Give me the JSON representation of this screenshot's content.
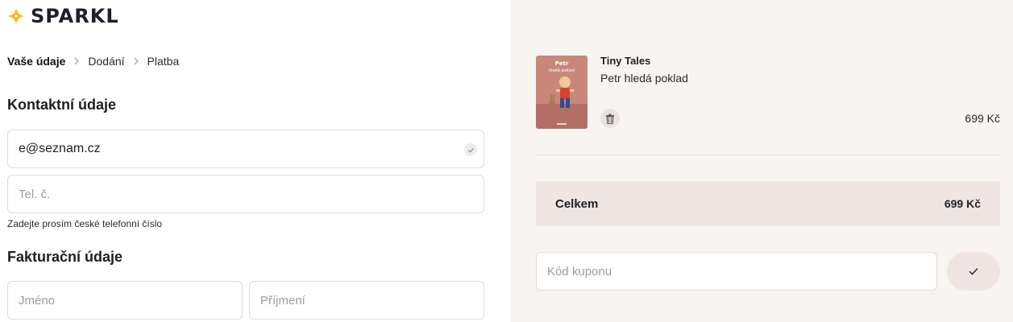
{
  "brand": {
    "name": "SPARKL",
    "logo_icon": "sparkle-icon",
    "logo_color": "#f5b718"
  },
  "breadcrumb": [
    "Vaše údaje",
    "Dodání",
    "Platba"
  ],
  "contact": {
    "title": "Kontaktní údaje",
    "email_value": "e@seznam.cz",
    "phone_placeholder": "Tel. č.",
    "phone_hint": "Zadejte prosím české telefonní číslo"
  },
  "billing": {
    "title": "Fakturační údaje",
    "first_name_placeholder": "Jméno",
    "last_name_placeholder": "Příjmení"
  },
  "cart": {
    "item": {
      "brand": "Tiny Tales",
      "title": "Petr hledá poklad",
      "price": "699 Kč",
      "cover_text": "Petr hledá poklad"
    },
    "total_label": "Celkem",
    "total_value": "699 Kč",
    "coupon_placeholder": "Kód kuponu"
  },
  "colors": {
    "right_bg": "#f8f4f1",
    "total_bg": "#efe6e3"
  }
}
